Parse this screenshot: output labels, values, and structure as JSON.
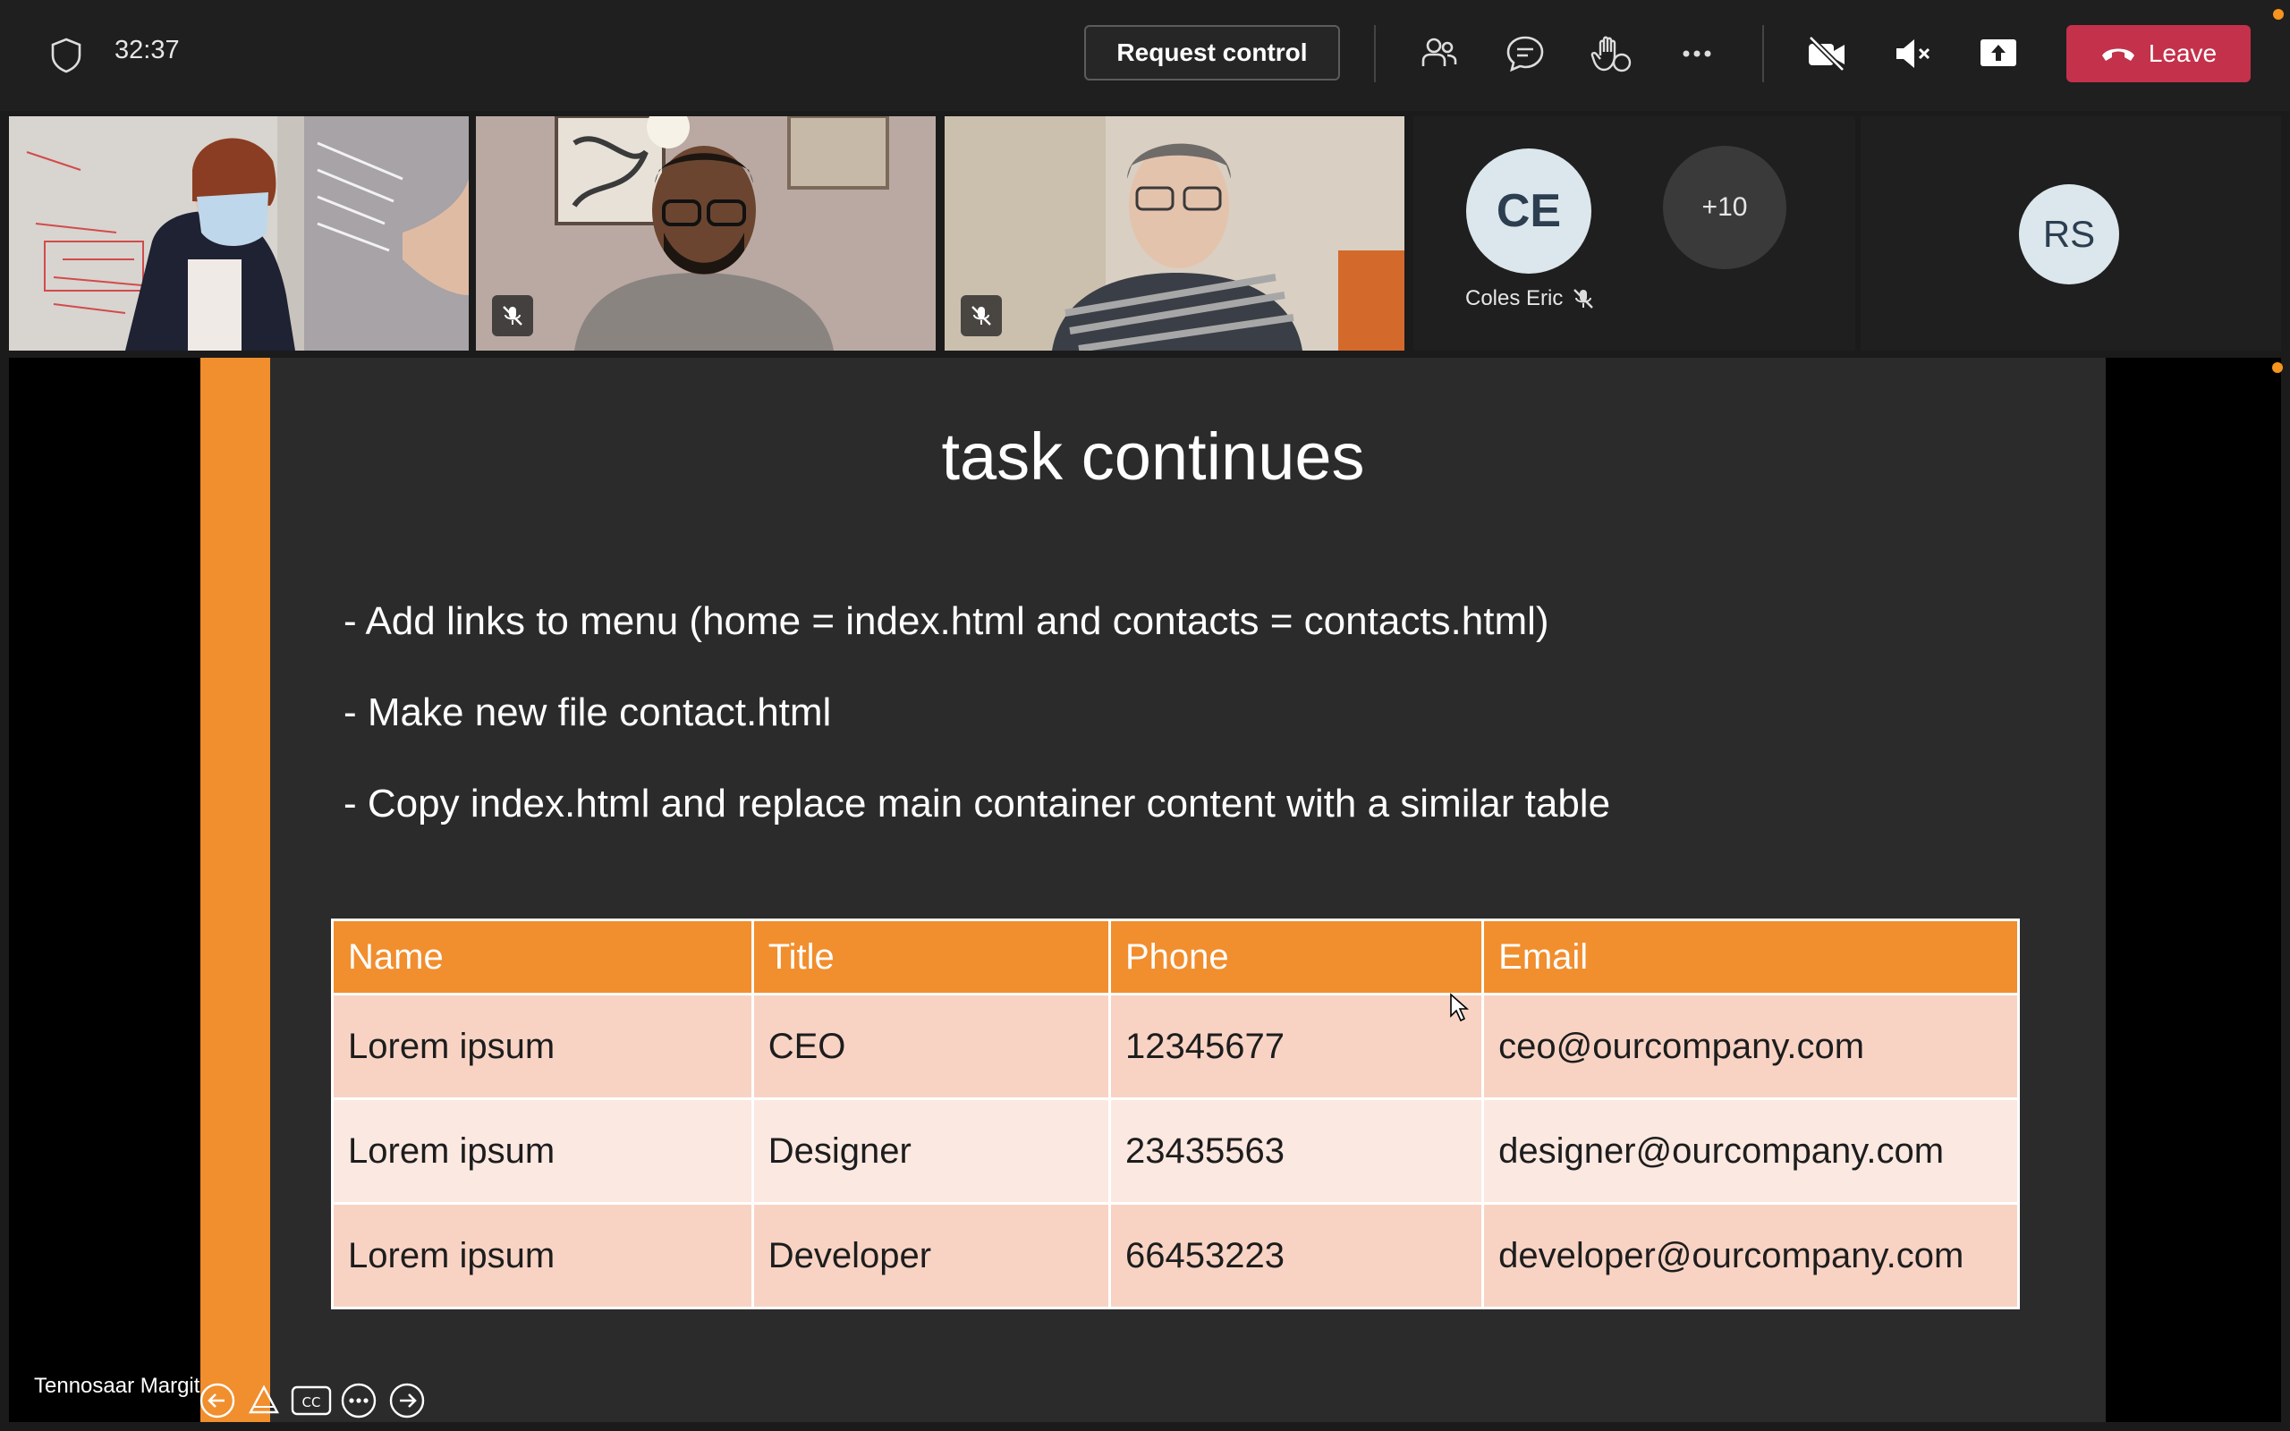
{
  "toolbar": {
    "timer": "32:37",
    "request_control_label": "Request control",
    "leave_label": "Leave",
    "icons": [
      "shield-icon",
      "people-icon",
      "chat-icon",
      "raise-hand-icon",
      "more-icon",
      "camera-off-icon",
      "speaker-muted-icon",
      "share-icon",
      "phone-hangup-icon"
    ]
  },
  "participants": {
    "ce": {
      "initials": "CE",
      "name": "Coles Eric"
    },
    "overflow": "+10",
    "rs": {
      "initials": "RS"
    }
  },
  "slide": {
    "title": "task continues",
    "bullets": [
      "- Add links to menu (home = index.html and contacts = contacts.html)",
      "- Make new file contact.html",
      "- Copy index.html and replace main container content with a similar table"
    ],
    "table": {
      "headers": [
        "Name",
        "Title",
        "Phone",
        "Email"
      ],
      "rows": [
        [
          "Lorem ipsum",
          "CEO",
          "12345677",
          "ceo@ourcompany.com"
        ],
        [
          "Lorem ipsum",
          "Designer",
          "23435563",
          "designer@ourcompany.com"
        ],
        [
          "Lorem ipsum",
          "Developer",
          "66453223",
          "developer@ourcompany.com"
        ]
      ]
    }
  },
  "presenter": {
    "name": "Tennosaar Margit"
  },
  "colors": {
    "accent": "#f18e2e",
    "leave": "#c4314b",
    "avatar_bg": "#dbe7ec"
  }
}
